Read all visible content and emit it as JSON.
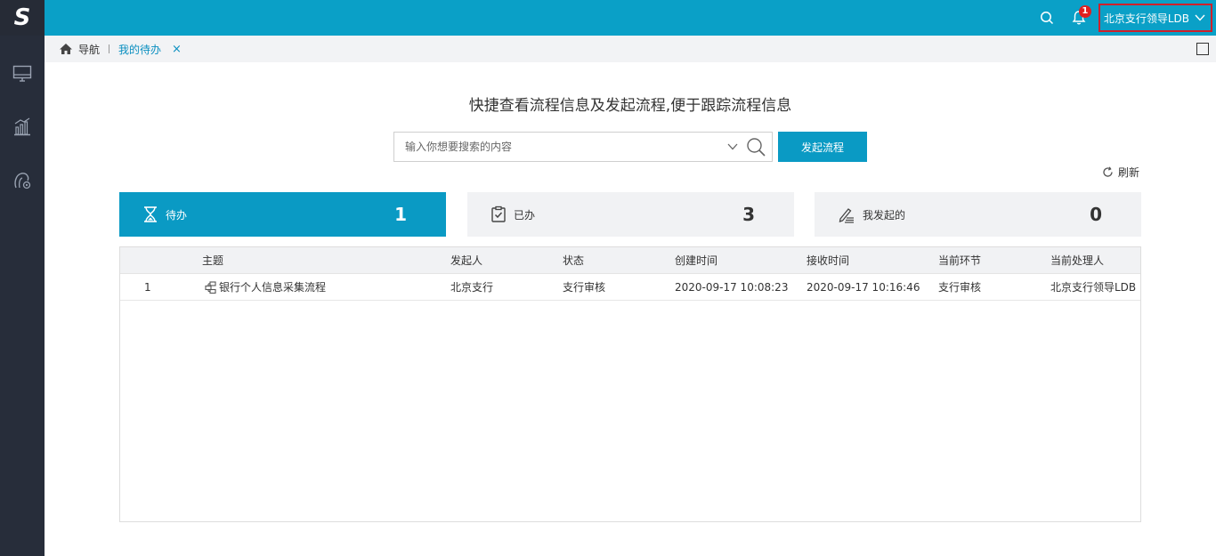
{
  "app": {
    "logo": "S"
  },
  "topbar": {
    "user_name": "北京支行领导LDB",
    "notifications_count": "1"
  },
  "sidebar": {
    "items": [
      {
        "icon": "monitor-icon"
      },
      {
        "icon": "chart-icon"
      },
      {
        "icon": "workflow-icon"
      }
    ]
  },
  "breadcrumb": {
    "home_label": "导航",
    "active_tab": "我的待办",
    "close": "×"
  },
  "main": {
    "headline": "快捷查看流程信息及发起流程,便于跟踪流程信息",
    "search_placeholder": "输入你想要搜索的内容",
    "start_button": "发起流程",
    "refresh_label": "刷新"
  },
  "cards": [
    {
      "label": "待办",
      "count": "1",
      "icon": "hourglass-icon",
      "active": true
    },
    {
      "label": "已办",
      "count": "3",
      "icon": "clipboard-check-icon",
      "active": false
    },
    {
      "label": "我发起的",
      "count": "0",
      "icon": "pen-list-icon",
      "active": false
    }
  ],
  "table": {
    "headers": {
      "topic": "主题",
      "initiator": "发起人",
      "status": "状态",
      "created": "创建时间",
      "received": "接收时间",
      "node": "当前环节",
      "handler": "当前处理人"
    },
    "rows": [
      {
        "index": "1",
        "topic": "银行个人信息采集流程",
        "initiator": "北京支行",
        "status": "支行审核",
        "created": "2020-09-17 10:08:23",
        "received": "2020-09-17 10:16:46",
        "node": "支行审核",
        "handler": "北京支行领导LDB"
      }
    ]
  }
}
